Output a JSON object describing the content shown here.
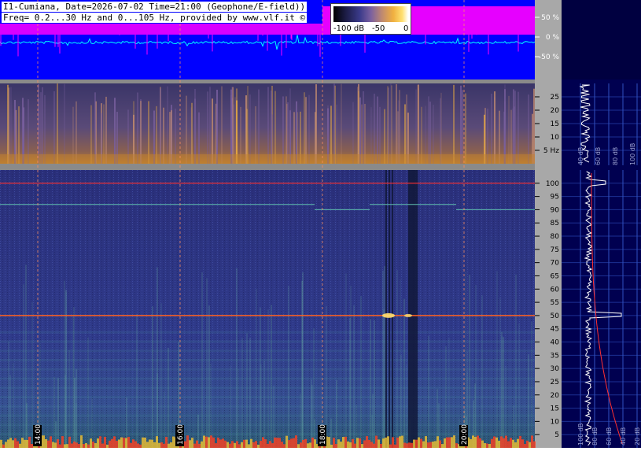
{
  "header": {
    "line1": "I1-Cumiana, Date=2026-07-02 Time=21:00 (Geophone/E-field))",
    "line2": "Freq= 0.2...30 Hz and 0...105 Hz, provided by www.vlf.it ©"
  },
  "colorbar": {
    "min_label": "-100 dB",
    "mid_label": "-50",
    "max_label": "0"
  },
  "chart_data": [
    {
      "type": "line",
      "name": "waveform-panel",
      "yticks": [
        "50 %",
        "0 %",
        "-50 %"
      ],
      "ylim": [
        -100,
        100
      ],
      "colors": {
        "background": "#0000ff",
        "trace": "#ff00ff",
        "zero_trace": "#00ffff"
      }
    },
    {
      "type": "heatmap",
      "name": "low-frequency-spectrogram",
      "ylim": [
        0,
        30
      ],
      "yticks": [
        "25",
        "20",
        "15",
        "10",
        "5 Hz"
      ],
      "side_labels": [
        "40 dB",
        "60 dB",
        "80 dB",
        "100 dB"
      ]
    },
    {
      "type": "heatmap",
      "name": "high-frequency-spectrogram",
      "ylim": [
        0,
        105
      ],
      "yticks": [
        "100",
        "95",
        "90",
        "85",
        "80",
        "75",
        "70",
        "65",
        "60",
        "55",
        "50",
        "45",
        "40",
        "35",
        "30",
        "25",
        "20",
        "15",
        "10",
        "5"
      ],
      "side_labels": [
        "100 dB",
        "80 dB",
        "60 dB",
        "40 dB",
        "20 dB"
      ],
      "xticks": [
        "14:00",
        "16:00",
        "18:00",
        "20:00"
      ],
      "lines_hz": [
        100,
        92,
        90,
        50
      ],
      "colors": {
        "line_100hz": "#ff3030",
        "line_50hz": "#ff6020"
      }
    }
  ]
}
